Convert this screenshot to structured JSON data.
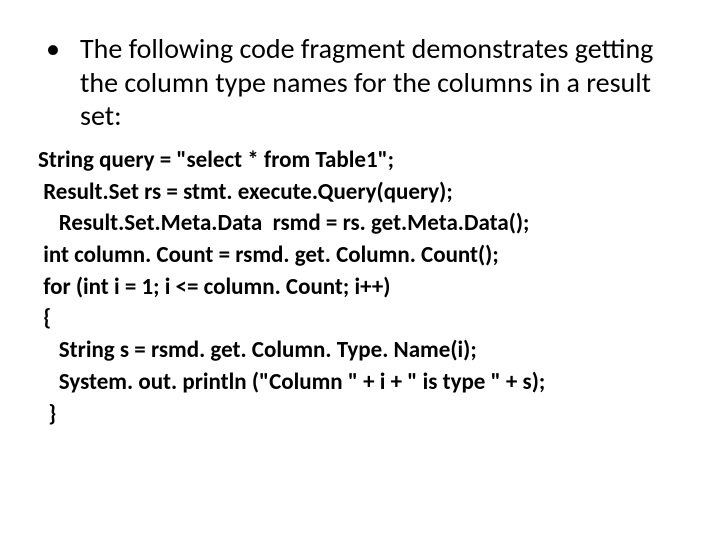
{
  "bullet": {
    "marker": "•",
    "text": "The following code fragment demonstrates getting the column type names for the columns in a result set:"
  },
  "code": {
    "l1": "String query = \"select * from Table1\";",
    "l2": " Result.Set rs = stmt. execute.Query(query);",
    "l3": "    Result.Set.Meta.Data  rsmd = rs. get.Meta.Data();",
    "l4": " int column. Count = rsmd. get. Column. Count();",
    "l5": " for (int i = 1; i <= column. Count; i++)",
    "l6": " {",
    "l7": "    String s = rsmd. get. Column. Type. Name(i);",
    "l8": "    System. out. println (\"Column \" + i + \" is type \" + s);",
    "l9": "  }"
  }
}
